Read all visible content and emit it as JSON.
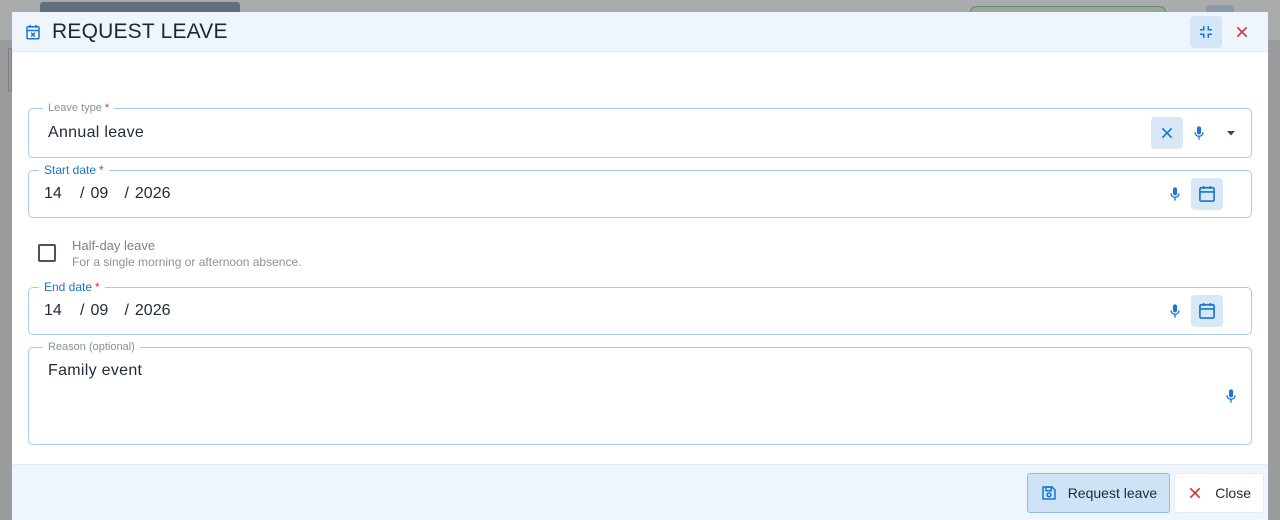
{
  "dialog": {
    "title": "REQUEST LEAVE",
    "title_icon": "calendar-x-icon",
    "fullscreen_icon": "exit-fullscreen-icon",
    "close_icon": "close-icon"
  },
  "form": {
    "leave_type": {
      "label": "Leave type",
      "required_mark": "*",
      "value": "Annual leave"
    },
    "start_date": {
      "label": "Start date",
      "required_mark": "*",
      "day": "14",
      "month": "09",
      "year": "2026",
      "separator": "/"
    },
    "half_day": {
      "label": "Half-day leave",
      "help": "For a single morning or afternoon absence.",
      "checked": false
    },
    "end_date": {
      "label": "End date",
      "required_mark": "*",
      "day": "14",
      "month": "09",
      "year": "2026",
      "separator": "/"
    },
    "reason": {
      "label": "Reason (optional)",
      "value": "Family event"
    }
  },
  "footer": {
    "submit_label": "Request leave",
    "close_label": "Close"
  },
  "colors": {
    "accent": "#1976d2",
    "danger": "#d32f2f",
    "header_bg": "#eef5fd"
  }
}
